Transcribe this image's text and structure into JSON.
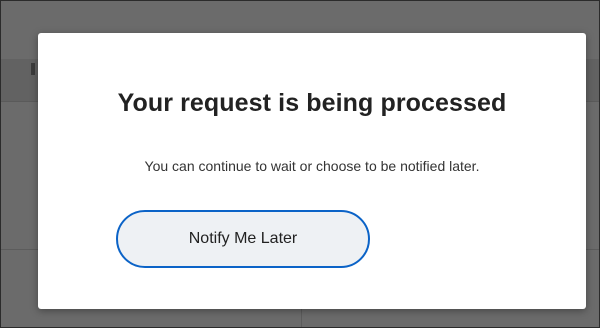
{
  "dialog": {
    "title": "Your request is being processed",
    "message": "You can continue to wait or choose to be notified later.",
    "notify_button_label": "Notify Me Later"
  },
  "colors": {
    "overlay": "#6b6b6b",
    "dialog_background": "#ffffff",
    "button_border": "#0b63c7",
    "button_background": "#eef1f4",
    "text": "#222222"
  }
}
